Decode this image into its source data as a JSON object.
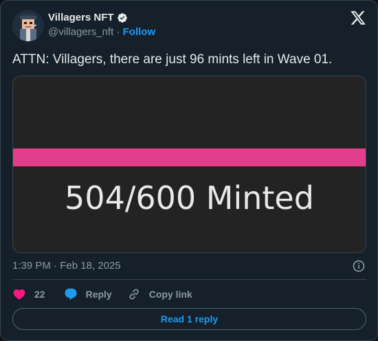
{
  "author": {
    "display_name": "Villagers NFT",
    "handle": "@villagers_nft",
    "separator": "·",
    "follow_label": "Follow"
  },
  "tweet": {
    "text": "ATTN: Villagers, there are just 96 mints left in Wave 01.",
    "timestamp": "1:39 PM · Feb 18, 2025"
  },
  "media": {
    "minted_text": "504/600 Minted",
    "bar_color": "#e33d8e"
  },
  "actions": {
    "like_count": "22",
    "reply_label": "Reply",
    "copy_link_label": "Copy link"
  },
  "read_replies_label": "Read 1 reply",
  "icons": [
    "verified-badge-icon",
    "x-logo-icon",
    "info-icon",
    "heart-icon",
    "reply-bubble-icon",
    "link-icon"
  ],
  "colors": {
    "accent": "#1d9bf0",
    "like": "#f91880",
    "background": "#15202b"
  }
}
